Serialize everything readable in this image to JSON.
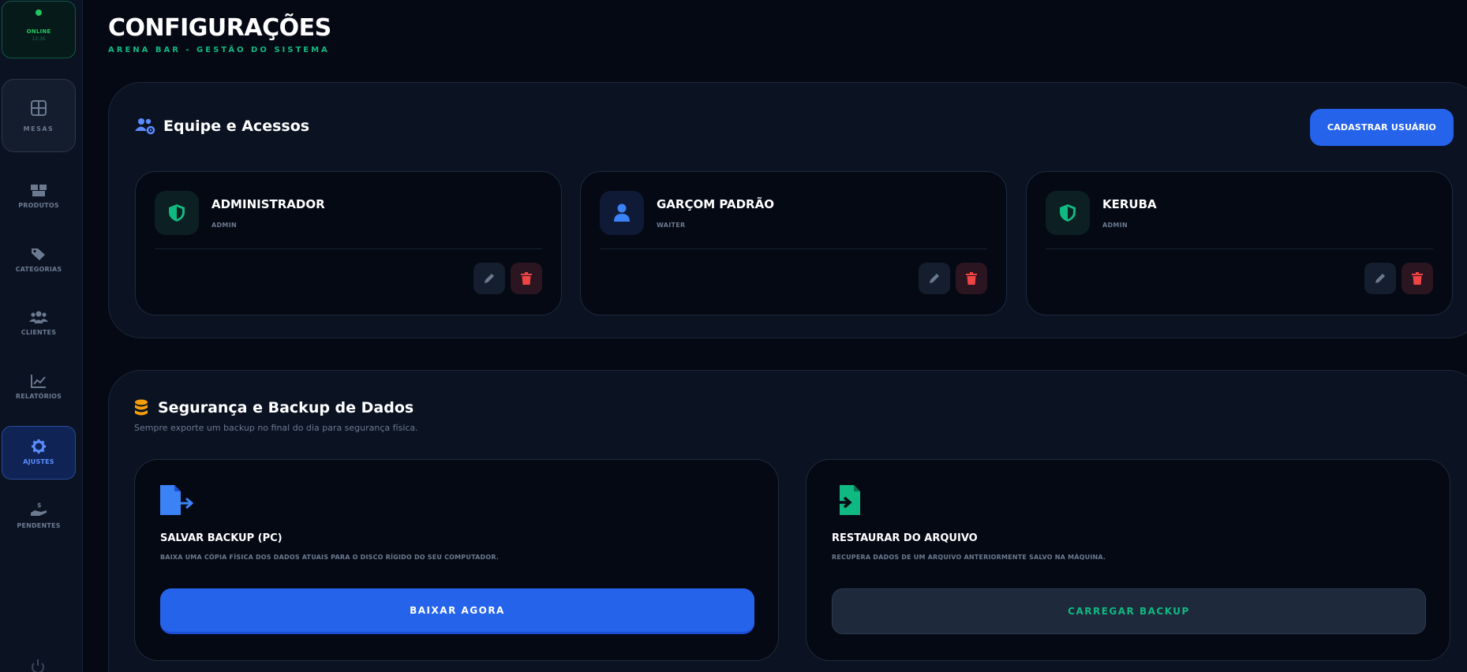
{
  "status": {
    "label": "ONLINE",
    "time": "13:36"
  },
  "sidebar": {
    "items": [
      {
        "label": "MESAS",
        "icon": "grid-icon"
      },
      {
        "label": "PRODUTOS",
        "icon": "boxes-icon"
      },
      {
        "label": "CATEGORIAS",
        "icon": "tags-icon"
      },
      {
        "label": "CLIENTES",
        "icon": "users-icon"
      },
      {
        "label": "RELATÓRIOS",
        "icon": "chart-line-icon"
      },
      {
        "label": "AJUSTES",
        "icon": "gear-icon"
      },
      {
        "label": "PENDENTES",
        "icon": "hand-dollar-icon"
      }
    ],
    "active": "AJUSTES"
  },
  "header": {
    "title": "CONFIGURAÇÕES",
    "subtitle": "ARENA BAR - GESTÃO DO SISTEMA"
  },
  "team": {
    "title": "Equipe e Acessos",
    "add_button": "CADASTRAR USUÁRIO",
    "users": [
      {
        "name": "ADMINISTRADOR",
        "role": "ADMIN",
        "icon": "shield-icon"
      },
      {
        "name": "GARÇOM PADRÃO",
        "role": "WAITER",
        "icon": "user-icon"
      },
      {
        "name": "KERUBA",
        "role": "ADMIN",
        "icon": "shield-icon"
      }
    ]
  },
  "backup": {
    "title": "Segurança e Backup de Dados",
    "description": "Sempre exporte um backup no final do dia para segurança física.",
    "save": {
      "title": "SALVAR BACKUP (PC)",
      "description": "BAIXA UMA CÓPIA FÍSICA DOS DADOS ATUAIS PARA O DISCO RÍGIDO DO SEU COMPUTADOR.",
      "button": "BAIXAR AGORA"
    },
    "restore": {
      "title": "RESTAURAR DO ARQUIVO",
      "description": "RECUPERA DADOS DE UM ARQUIVO ANTERIORMENTE SALVO NA MÁQUINA.",
      "button": "CARREGAR BACKUP"
    }
  },
  "colors": {
    "accent": "#2563eb",
    "success": "#10b981",
    "danger": "#ef4444",
    "warning": "#f59e0b",
    "background": "#050914"
  }
}
